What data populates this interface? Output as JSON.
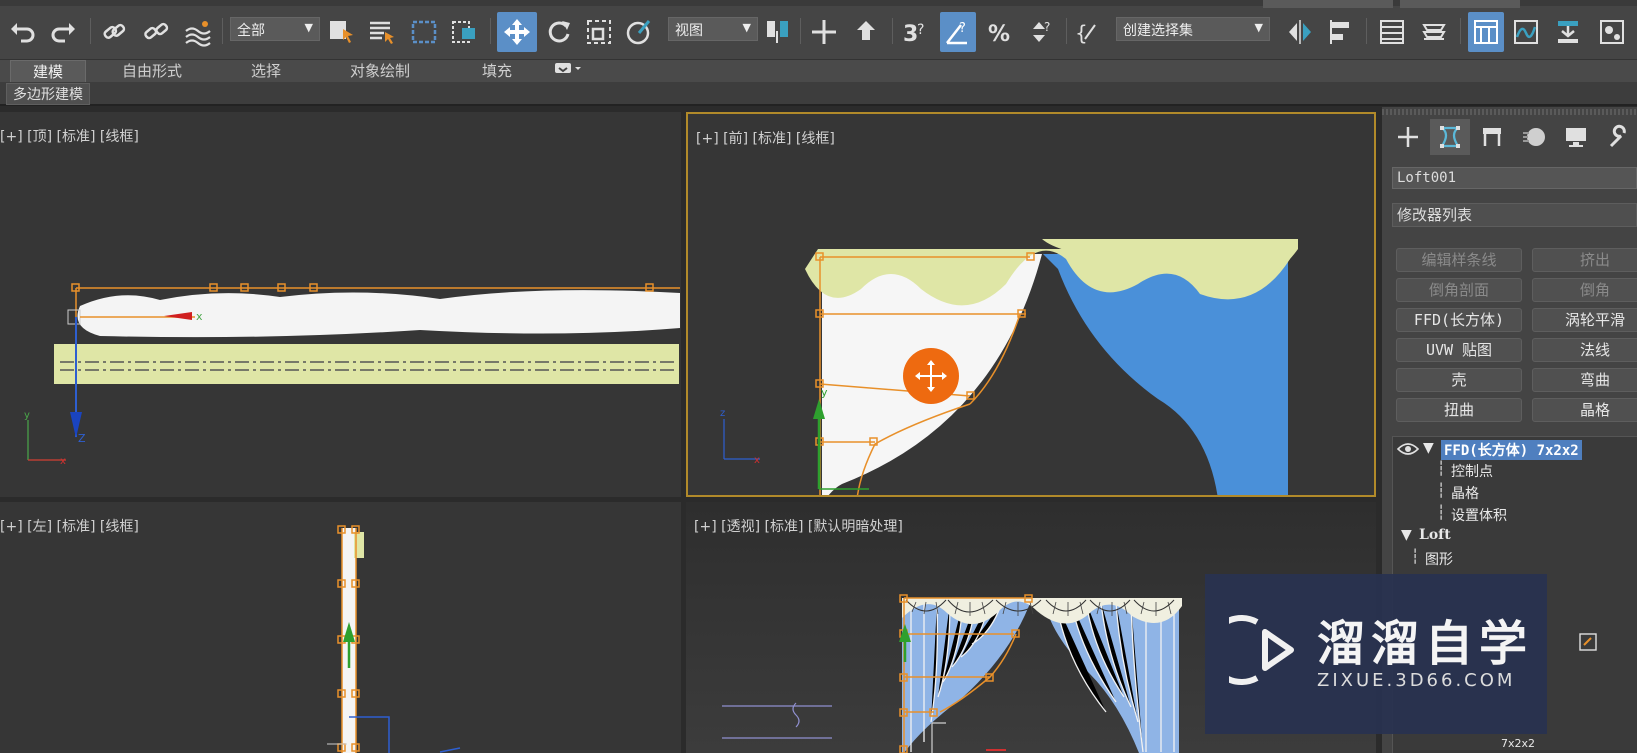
{
  "toolbar": {
    "selection_filter": "全部",
    "ref_coord": "视图",
    "named_selection": "创建选择集",
    "icons": [
      "undo-icon",
      "redo-icon",
      "link-icon",
      "unlink-icon",
      "bind-space-warp-icon",
      "select-object-icon",
      "select-by-name-icon",
      "rect-region-icon",
      "window-crossing-icon",
      "move-icon",
      "rotate-icon",
      "scale-icon",
      "select-manipulate-icon",
      "use-pivot-icon",
      "mirror-icon",
      "snap-3d-icon",
      "angle-snap-icon",
      "percent-snap-icon",
      "spinner-snap-icon",
      "edit-named-sel-icon",
      "mirror-tool-icon",
      "align-icon",
      "layer-explorer-icon",
      "scene-explorer-icon",
      "ribbon-toggle-icon",
      "curve-editor-icon",
      "schematic-view-icon",
      "material-editor-icon"
    ]
  },
  "ribbon": {
    "tabs": [
      {
        "label": "建模",
        "active": true
      },
      {
        "label": "自由形式",
        "active": false
      },
      {
        "label": "选择",
        "active": false
      },
      {
        "label": "对象绘制",
        "active": false
      },
      {
        "label": "填充",
        "active": false
      }
    ],
    "panel_label": "多边形建模"
  },
  "viewports": {
    "top": "[+] [顶] [标准] [线框]",
    "front": "[+] [前] [标准] [线框]",
    "left": "[+] [左] [标准] [线框]",
    "perspective": "[+] [透视] [标准] [默认明暗处理]"
  },
  "command_panel": {
    "tabs": [
      "create-icon",
      "modify-icon",
      "hierarchy-icon",
      "motion-icon",
      "display-icon",
      "utilities-icon"
    ],
    "object_name": "Loft001",
    "modifier_list": "修改器列表",
    "buttons": [
      {
        "label": "编辑样条线",
        "enabled": false
      },
      {
        "label": "挤出",
        "enabled": false
      },
      {
        "label": "倒角剖面",
        "enabled": false
      },
      {
        "label": "倒角",
        "enabled": false
      },
      {
        "label": "FFD(长方体)",
        "enabled": true
      },
      {
        "label": "涡轮平滑",
        "enabled": true
      },
      {
        "label": "UVW 贴图",
        "enabled": true
      },
      {
        "label": "法线",
        "enabled": true
      },
      {
        "label": "壳",
        "enabled": true
      },
      {
        "label": "弯曲",
        "enabled": true
      },
      {
        "label": "扭曲",
        "enabled": true
      },
      {
        "label": "晶格",
        "enabled": true
      }
    ],
    "stack": {
      "ffd": "FFD(长方体) 7x2x2",
      "ffd_children": [
        "控制点",
        "晶格",
        "设置体积"
      ],
      "loft": "Loft",
      "loft_children": [
        "图形"
      ],
      "bottom_text": "7x2x2"
    }
  },
  "watermark": {
    "title": "溜溜自学",
    "subtitle": "ZIXUE.3D66.COM"
  },
  "colors": {
    "accent": "#5b8fc7",
    "selection_orange": "#e8902a",
    "curtain_valance": "#dfe6a6",
    "curtain_blue": "#4a90d9",
    "viewport_active_border": "#b18a2a"
  }
}
